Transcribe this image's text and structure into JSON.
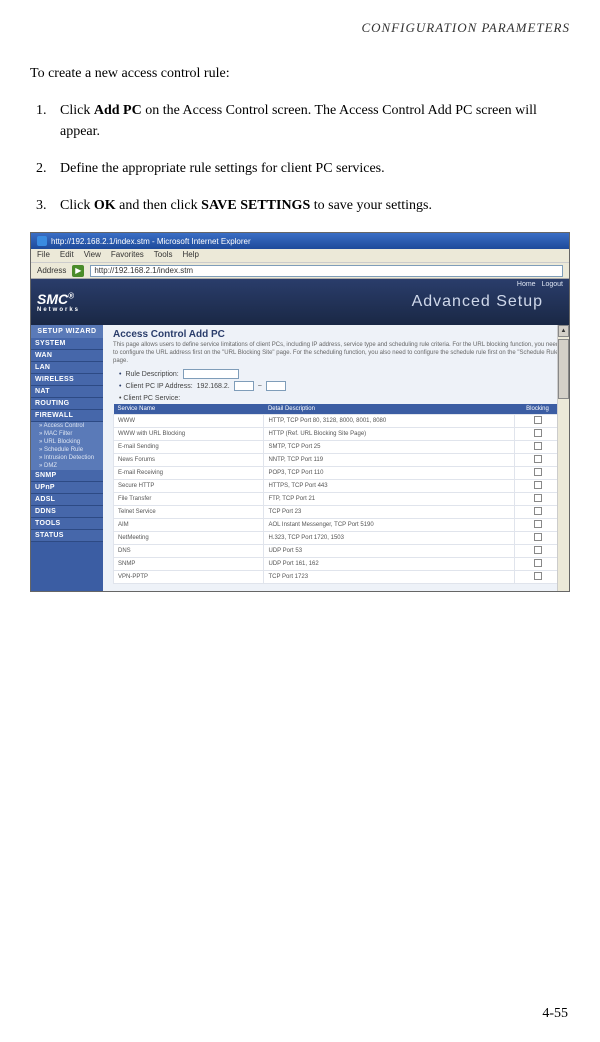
{
  "pageHeader": "CONFIGURATION PARAMETERS",
  "intro": "To create a new access control rule:",
  "steps": {
    "s1_pre": "Click ",
    "s1_b": "Add PC",
    "s1_post": " on the Access Control screen. The Access Control Add PC screen will appear.",
    "s2": "Define the appropriate rule settings for client PC services.",
    "s3_pre": "Click ",
    "s3_b1": "OK",
    "s3_mid": " and then click ",
    "s3_b2": "SAVE SETTINGS",
    "s3_post": " to save your settings."
  },
  "browser": {
    "title": "http://192.168.2.1/index.stm - Microsoft Internet Explorer",
    "menu": [
      "File",
      "Edit",
      "View",
      "Favorites",
      "Tools",
      "Help"
    ],
    "addressLabel": "Address",
    "addressValue": "http://192.168.2.1/index.stm"
  },
  "ui": {
    "logo": "SMC",
    "logoSub": "Networks",
    "bannerTitle": "Advanced Setup",
    "topLinks": [
      "Home",
      "Logout"
    ],
    "setupWizard": "SETUP WIZARD",
    "nav": [
      "SYSTEM",
      "WAN",
      "LAN",
      "WIRELESS",
      "NAT",
      "ROUTING",
      "FIREWALL"
    ],
    "firewallSubs": [
      "» Access Control",
      "» MAC Filter",
      "» URL Blocking",
      "» Schedule Rule",
      "» Intrusion Detection",
      "» DMZ"
    ],
    "nav2": [
      "SNMP",
      "UPnP",
      "ADSL",
      "DDNS",
      "TOOLS",
      "STATUS"
    ],
    "pageTitle": "Access Control Add PC",
    "pageDesc": "This page allows users to define service limitations of client PCs, including IP address, service type and scheduling rule criteria. For the URL blocking function, you need to configure the URL address first on the \"URL Blocking Site\" page. For the scheduling function, you also need to configure the schedule rule first on the \"Schedule Rule\" page.",
    "ruleDescLabel": "Rule Description:",
    "ipLabel": "Client PC IP Address:",
    "ipPrefix": "192.168.2.",
    "svcLabel": "Client PC Service:",
    "cols": [
      "Service Name",
      "Detail Description",
      "Blocking"
    ],
    "rows": [
      {
        "name": "WWW",
        "desc": "HTTP, TCP Port 80, 3128, 8000, 8001, 8080"
      },
      {
        "name": "WWW with URL Blocking",
        "desc": "HTTP (Ref. URL Blocking Site Page)"
      },
      {
        "name": "E-mail Sending",
        "desc": "SMTP, TCP Port 25"
      },
      {
        "name": "News Forums",
        "desc": "NNTP, TCP Port 119"
      },
      {
        "name": "E-mail Receiving",
        "desc": "POP3, TCP Port 110"
      },
      {
        "name": "Secure HTTP",
        "desc": "HTTPS, TCP Port 443"
      },
      {
        "name": "File Transfer",
        "desc": "FTP, TCP Port 21"
      },
      {
        "name": "Telnet Service",
        "desc": "TCP Port 23"
      },
      {
        "name": "AIM",
        "desc": "AOL Instant Messenger, TCP Port 5190"
      },
      {
        "name": "NetMeeting",
        "desc": "H.323, TCP Port 1720, 1503"
      },
      {
        "name": "DNS",
        "desc": "UDP Port 53"
      },
      {
        "name": "SNMP",
        "desc": "UDP Port 161, 162"
      },
      {
        "name": "VPN-PPTP",
        "desc": "TCP Port 1723"
      }
    ]
  },
  "pageNumber": "4-55"
}
